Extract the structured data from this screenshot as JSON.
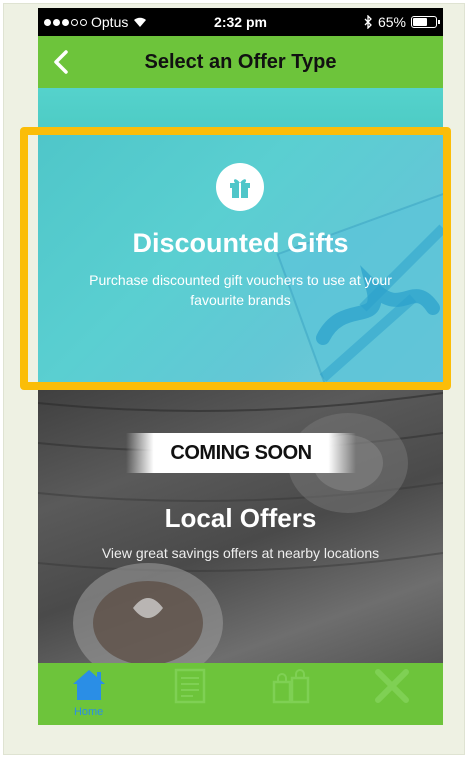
{
  "status_bar": {
    "carrier": "Optus",
    "time": "2:32 pm",
    "battery": "65%",
    "battery_level": 0.65
  },
  "nav": {
    "title": "Select an Offer Type",
    "back_icon": "chevron-left-icon"
  },
  "offers": [
    {
      "title": "Discounted Gifts",
      "description": "Purchase discounted gift vouchers to use at your favourite brands",
      "icon": "gift-icon"
    },
    {
      "badge": "COMING SOON",
      "title": "Local Offers",
      "description": "View great savings offers at nearby locations"
    }
  ],
  "tabs": [
    {
      "label": "Home",
      "icon": "home-icon",
      "active": true
    },
    {
      "label": "",
      "icon": "document-icon",
      "active": false
    },
    {
      "label": "",
      "icon": "bags-icon",
      "active": false
    },
    {
      "label": "",
      "icon": "close-icon",
      "active": false
    }
  ],
  "colors": {
    "brand_green": "#6dc43b",
    "highlight": "#fbbd08",
    "active_tab": "#2a8ee6"
  }
}
